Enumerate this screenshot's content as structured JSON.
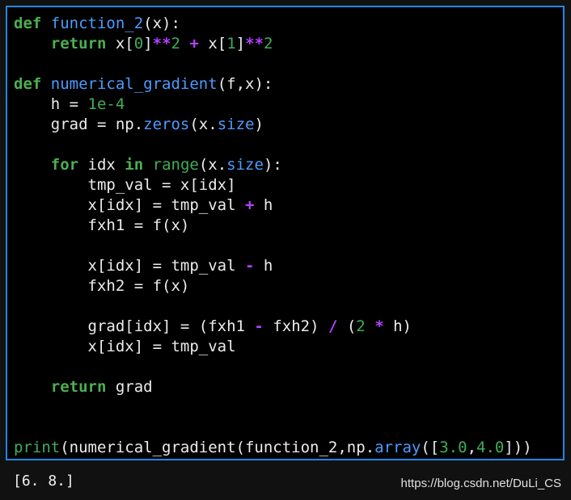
{
  "colors": {
    "cell_border": "#1e88e5",
    "keyword": "#4caf50",
    "function_name": "#4d9bff",
    "number": "#3fae5a",
    "operator": "#b540ff",
    "text": "#ececec"
  },
  "code_cell": {
    "lines": [
      [
        [
          "keyword",
          "def"
        ],
        [
          "plain",
          " "
        ],
        [
          "function",
          "function_2"
        ],
        [
          "plain",
          "(x):"
        ]
      ],
      [
        [
          "plain",
          "    "
        ],
        [
          "keyword",
          "return"
        ],
        [
          "plain",
          " x["
        ],
        [
          "number",
          "0"
        ],
        [
          "plain",
          "]"
        ],
        [
          "operator",
          "**"
        ],
        [
          "number",
          "2"
        ],
        [
          "plain",
          " "
        ],
        [
          "operator",
          "+"
        ],
        [
          "plain",
          " x["
        ],
        [
          "number",
          "1"
        ],
        [
          "plain",
          "]"
        ],
        [
          "operator",
          "**"
        ],
        [
          "number",
          "2"
        ]
      ],
      [],
      [
        [
          "keyword",
          "def"
        ],
        [
          "plain",
          " "
        ],
        [
          "function",
          "numerical_gradient"
        ],
        [
          "plain",
          "(f,x):"
        ]
      ],
      [
        [
          "plain",
          "    h = "
        ],
        [
          "number",
          "1e-4"
        ]
      ],
      [
        [
          "plain",
          "    grad = np."
        ],
        [
          "attr",
          "zeros"
        ],
        [
          "plain",
          "(x."
        ],
        [
          "attr",
          "size"
        ],
        [
          "plain",
          ")"
        ]
      ],
      [],
      [
        [
          "plain",
          "    "
        ],
        [
          "keyword",
          "for"
        ],
        [
          "plain",
          " idx "
        ],
        [
          "keyword",
          "in"
        ],
        [
          "plain",
          " "
        ],
        [
          "builtin",
          "range"
        ],
        [
          "plain",
          "(x."
        ],
        [
          "attr",
          "size"
        ],
        [
          "plain",
          "):"
        ]
      ],
      [
        [
          "plain",
          "        tmp_val = x[idx]"
        ]
      ],
      [
        [
          "plain",
          "        x[idx] = tmp_val "
        ],
        [
          "operator",
          "+"
        ],
        [
          "plain",
          " h"
        ]
      ],
      [
        [
          "plain",
          "        fxh1 = f(x)"
        ]
      ],
      [],
      [
        [
          "plain",
          "        x[idx] = tmp_val "
        ],
        [
          "operator",
          "-"
        ],
        [
          "plain",
          " h"
        ]
      ],
      [
        [
          "plain",
          "        fxh2 = f(x)"
        ]
      ],
      [],
      [
        [
          "plain",
          "        grad[idx] = (fxh1 "
        ],
        [
          "operator",
          "-"
        ],
        [
          "plain",
          " fxh2) "
        ],
        [
          "operator",
          "/"
        ],
        [
          "plain",
          " ("
        ],
        [
          "number",
          "2"
        ],
        [
          "plain",
          " "
        ],
        [
          "operator",
          "*"
        ],
        [
          "plain",
          " h)"
        ]
      ],
      [
        [
          "plain",
          "        x[idx] = tmp_val"
        ]
      ],
      [],
      [
        [
          "plain",
          "    "
        ],
        [
          "keyword",
          "return"
        ],
        [
          "plain",
          " grad"
        ]
      ],
      [],
      [],
      [
        [
          "builtin",
          "print"
        ],
        [
          "plain",
          "(numerical_gradient(function_2,np."
        ],
        [
          "attr",
          "array"
        ],
        [
          "plain",
          "(["
        ],
        [
          "number",
          "3.0"
        ],
        [
          "plain",
          ","
        ],
        [
          "number",
          "4.0"
        ],
        [
          "plain",
          "]))"
        ]
      ]
    ]
  },
  "output": {
    "text": "[6. 8.]"
  },
  "watermark": {
    "text": "https://blog.csdn.net/DuLi_CS"
  }
}
